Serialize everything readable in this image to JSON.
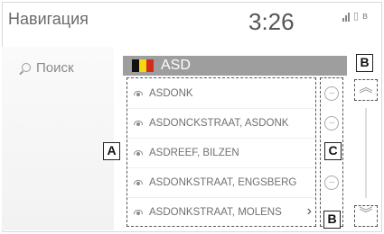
{
  "header": {
    "title": "Навигация",
    "time": "3:26"
  },
  "status_icons": [
    "signal-icon",
    "phone-icon",
    "bluetooth-icon"
  ],
  "sidebar": {
    "search_label": "Поиск"
  },
  "results": {
    "header_label": "ASD",
    "flag_colors": [
      "#111111",
      "#f5d80f",
      "#d52b1e"
    ],
    "items": [
      {
        "label": "ASDONK",
        "has_options": true,
        "has_chevron": false
      },
      {
        "label": "ASDONCKSTRAAT, ASDONK",
        "has_options": true,
        "has_chevron": false
      },
      {
        "label": "ASDREEF, BILZEN",
        "has_options": true,
        "has_chevron": false
      },
      {
        "label": "ASDONKSTRAAT, ENGSBERG",
        "has_options": true,
        "has_chevron": false
      },
      {
        "label": "ASDONKSTRAAT, MOLENS",
        "has_options": false,
        "has_chevron": true
      }
    ],
    "options_glyph": "···",
    "row_chevron": "›"
  },
  "scroll": {
    "up_glyph": "︽",
    "down_glyph": "︾"
  },
  "callouts": {
    "a": "A",
    "b_top": "B",
    "b_bottom": "B",
    "c": "C"
  }
}
